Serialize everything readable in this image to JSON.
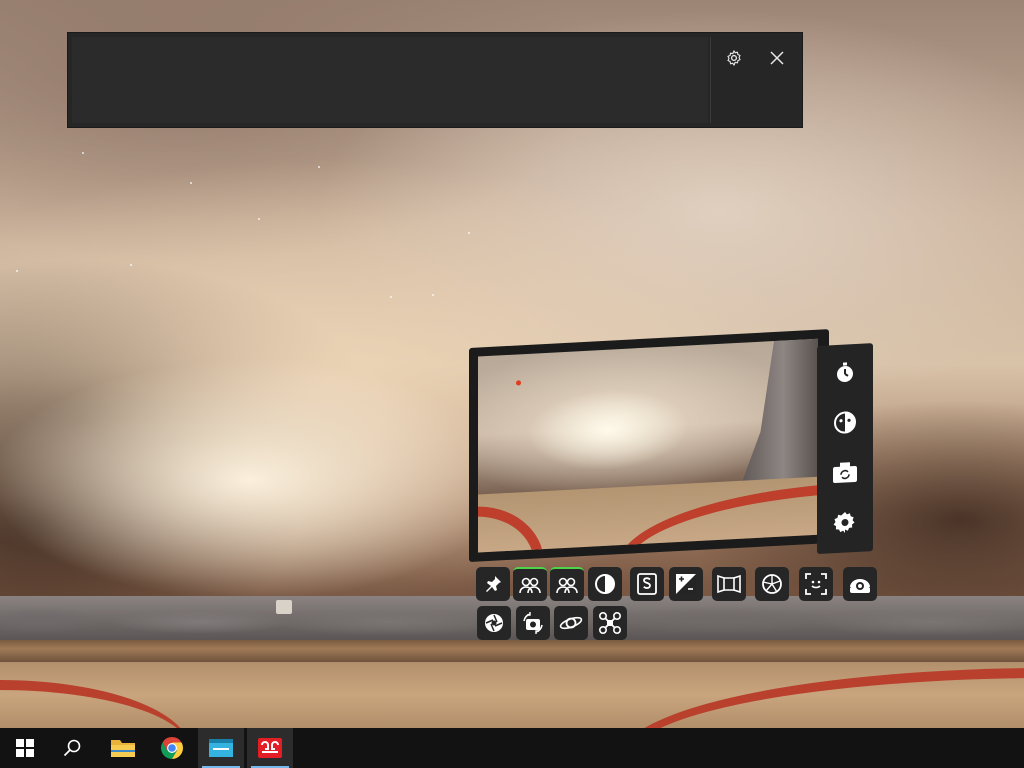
{
  "window": {
    "title": ""
  },
  "top_panel": {
    "settings_icon": "gear-icon",
    "close_icon": "close-icon"
  },
  "camera_widget": {
    "sidebar_buttons": [
      {
        "name": "timer",
        "icon": "stopwatch-icon"
      },
      {
        "name": "face-swap",
        "icon": "face-toggle-icon"
      },
      {
        "name": "switch-camera",
        "icon": "camera-switch-icon"
      },
      {
        "name": "settings",
        "icon": "gear-icon"
      }
    ],
    "toolbar_row1": [
      {
        "name": "pin",
        "icon": "pin-icon",
        "active": false
      },
      {
        "name": "mode-a",
        "icon": "users-icon",
        "active": true
      },
      {
        "name": "mode-b",
        "icon": "users-icon",
        "active": true
      },
      {
        "name": "contrast",
        "icon": "contrast-icon",
        "active": false
      },
      {
        "name": "smoothing",
        "icon": "s-frame-icon",
        "active": false
      },
      {
        "name": "exposure",
        "icon": "exposure-icon",
        "active": false
      },
      {
        "name": "framing",
        "icon": "frame-icon",
        "active": false
      },
      {
        "name": "aperture",
        "icon": "aperture-icon",
        "active": false
      },
      {
        "name": "face-focus",
        "icon": "face-focus-icon",
        "active": false
      },
      {
        "name": "webcam",
        "icon": "webcam-icon",
        "active": false
      }
    ],
    "toolbar_row2": [
      {
        "name": "shutter",
        "icon": "shutter-icon"
      },
      {
        "name": "capture",
        "icon": "camera-rotate-icon"
      },
      {
        "name": "orbit",
        "icon": "orbit-icon"
      },
      {
        "name": "drone",
        "icon": "drone-icon"
      }
    ]
  },
  "taskbar": {
    "items": [
      {
        "name": "start",
        "icon": "windows-icon"
      },
      {
        "name": "search",
        "icon": "search-icon"
      },
      {
        "name": "file-explorer",
        "icon": "folder-icon"
      },
      {
        "name": "chrome",
        "icon": "chrome-icon"
      },
      {
        "name": "app-window",
        "icon": "window-icon",
        "active": true
      },
      {
        "name": "app-vr",
        "icon": "vr-logo-icon",
        "active": true
      }
    ],
    "accent_color": "#76b9ed"
  },
  "colors": {
    "toolbar_active": "#4fd34a",
    "record_dot": "#e03a1f"
  }
}
